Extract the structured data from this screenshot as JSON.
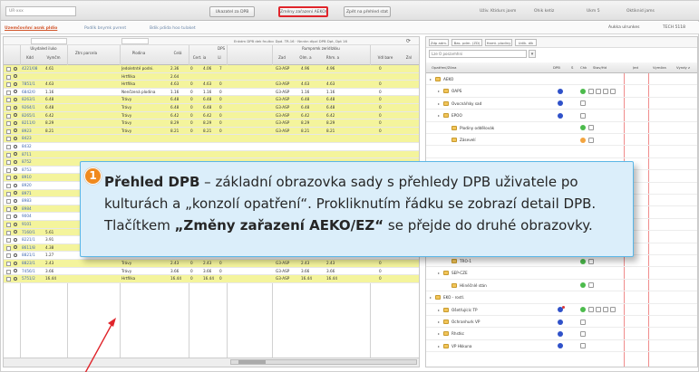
{
  "topbar": {
    "field_1": "UR·xxx",
    "button_1": "Ukazatel za DPB",
    "button_highlighted": "Změny zařazení AEKO/EZ",
    "button_3": "Zpět na přehled stat",
    "user_1": "Uživ. Ktidurs jaxm",
    "user_2": "Ohik ketiz",
    "user_3": "Ukm 5",
    "user_4": "Oktiknid jams"
  },
  "tabs": {
    "active": "Uzemčovňní asnk pldio",
    "tab_2": "Podílk bnymk pvrent",
    "tab_3": "Bdik pdida hoo tulaket",
    "right_label": "Aukka ulrunkes",
    "right_count": "TECH 5118"
  },
  "grid": {
    "filter_label": "Enkdm DPB dek fnultcc Dpd. TR.16 · Nnnkn dlpzl DPB Dpt, Dpt 16",
    "headers": {
      "group_1": "Ukydaled iluko",
      "group_2": "DPS",
      "group_3": "Rumpnmk zeridlzkku",
      "col_kod": "Kdd",
      "col_vymera": "Vymčm",
      "col_parcela": "Ztrs parcela",
      "col_plodina": "Plodina",
      "col_ha": "Celá",
      "col_cap": "Cert. ia",
      "col_ll": "Ll",
      "col_zad": "Zad",
      "col_obl": "Olm. a",
      "col_ha2": "Rhm. a",
      "col_val": "Vdl bare",
      "col_last": "Znl"
    },
    "rows": [
      {
        "kod": "4221/08",
        "vym": "4.61",
        "plod": "Jedoletnté podni.",
        "a": "2.36",
        "b": "0",
        "c": "4.06",
        "d": "7",
        "e": "G3·ASP",
        "f": "4.96",
        "g": "4.96",
        "h": "0"
      },
      {
        "kod": "",
        "vym": "",
        "plod": "Hrtfilka",
        "a": "2.64",
        "b": "",
        "c": "",
        "d": "",
        "e": "",
        "f": "",
        "g": "",
        "h": ""
      },
      {
        "kod": "7851/1",
        "vym": "4.63",
        "plod": "Hrtfilka",
        "a": "4.63",
        "b": "0",
        "c": "4.63",
        "d": "0",
        "e": "G3·ASP",
        "f": "4.63",
        "g": "4.63",
        "h": "0"
      },
      {
        "kod": "6842/0",
        "vym": "1.16",
        "plod": "Nenčzená plodina",
        "a": "1.16",
        "b": "0",
        "c": "1.16",
        "d": "0",
        "e": "G3·ASP",
        "f": "1.16",
        "g": "1.16",
        "h": "0"
      },
      {
        "kod": "8263/1",
        "vym": "6.48",
        "plod": "Trávy",
        "a": "6.48",
        "b": "0",
        "c": "6.48",
        "d": "0",
        "e": "G3·ASP",
        "f": "6.48",
        "g": "6.48",
        "h": "0"
      },
      {
        "kod": "9264/1",
        "vym": "6.48",
        "plod": "Trávy",
        "a": "6.48",
        "b": "0",
        "c": "6.48",
        "d": "0",
        "e": "G3·ASP",
        "f": "6.48",
        "g": "6.48",
        "h": "0"
      },
      {
        "kod": "8265/1",
        "vym": "6.42",
        "plod": "Trávy",
        "a": "6.42",
        "b": "0",
        "c": "6.42",
        "d": "0",
        "e": "G3·ASP",
        "f": "6.42",
        "g": "6.42",
        "h": "0"
      },
      {
        "kod": "8211/0",
        "vym": "8.29",
        "plod": "Trávy",
        "a": "8.29",
        "b": "0",
        "c": "8.29",
        "d": "0",
        "e": "G3·ASP",
        "f": "8.29",
        "g": "8.29",
        "h": "0"
      },
      {
        "kod": "8923",
        "vym": "8.21",
        "plod": "Trávy",
        "a": "8.21",
        "b": "0",
        "c": "8.21",
        "d": "0",
        "e": "G3·ASP",
        "f": "8.21",
        "g": "8.21",
        "h": "0"
      },
      {
        "kod": "8423",
        "vym": "",
        "plod": "",
        "a": "",
        "b": "",
        "c": "",
        "d": "",
        "e": "",
        "f": "",
        "g": "",
        "h": ""
      },
      {
        "kod": "8432",
        "vym": "",
        "plod": "",
        "a": "",
        "b": "",
        "c": "",
        "d": "",
        "e": "",
        "f": "",
        "g": "",
        "h": ""
      },
      {
        "kod": "8711",
        "vym": "",
        "plod": "",
        "a": "",
        "b": "",
        "c": "",
        "d": "",
        "e": "",
        "f": "",
        "g": "",
        "h": ""
      },
      {
        "kod": "8752",
        "vym": "",
        "plod": "",
        "a": "",
        "b": "",
        "c": "",
        "d": "",
        "e": "",
        "f": "",
        "g": "",
        "h": ""
      },
      {
        "kod": "8753",
        "vym": "",
        "plod": "",
        "a": "",
        "b": "",
        "c": "",
        "d": "",
        "e": "",
        "f": "",
        "g": "",
        "h": ""
      },
      {
        "kod": "8910",
        "vym": "",
        "plod": "",
        "a": "",
        "b": "",
        "c": "",
        "d": "",
        "e": "",
        "f": "",
        "g": "",
        "h": ""
      },
      {
        "kod": "8920",
        "vym": "",
        "plod": "",
        "a": "",
        "b": "",
        "c": "",
        "d": "",
        "e": "",
        "f": "",
        "g": "",
        "h": ""
      },
      {
        "kod": "8971",
        "vym": "",
        "plod": "",
        "a": "",
        "b": "",
        "c": "",
        "d": "",
        "e": "",
        "f": "",
        "g": "",
        "h": ""
      },
      {
        "kod": "8983",
        "vym": "",
        "plod": "",
        "a": "",
        "b": "",
        "c": "",
        "d": "",
        "e": "",
        "f": "",
        "g": "",
        "h": ""
      },
      {
        "kod": "8984",
        "vym": "",
        "plod": "",
        "a": "",
        "b": "",
        "c": "",
        "d": "",
        "e": "",
        "f": "",
        "g": "",
        "h": ""
      },
      {
        "kod": "9004",
        "vym": "",
        "plod": "",
        "a": "",
        "b": "",
        "c": "",
        "d": "",
        "e": "",
        "f": "",
        "g": "",
        "h": ""
      },
      {
        "kod": "9101",
        "vym": "",
        "plod": "",
        "a": "",
        "b": "",
        "c": "",
        "d": "",
        "e": "",
        "f": "",
        "g": "",
        "h": ""
      },
      {
        "kod": "7160/1",
        "vym": "5.61",
        "plod": "Hrtfilka",
        "a": "5.61",
        "b": "0",
        "c": "5.61",
        "d": "0",
        "e": "G3·ASP",
        "f": "5.61",
        "g": "5.61",
        "h": "0"
      },
      {
        "kod": "8221/1",
        "vym": "3.91",
        "plod": "Hrtfilka",
        "a": "3.91",
        "b": "0",
        "c": "3.91",
        "d": "0",
        "e": "G3·ASP",
        "f": "3.91",
        "g": "3.91",
        "h": "0"
      },
      {
        "kod": "8611/8",
        "vym": "4.38",
        "plod": "Trávy",
        "a": "4.38",
        "b": "0",
        "c": "4.38",
        "d": "0",
        "e": "G3·ASP",
        "f": "4.38",
        "g": "4.38",
        "h": "0"
      },
      {
        "kod": "8821/1",
        "vym": "1.27",
        "plod": "Trávy",
        "a": "1.27",
        "b": "0",
        "c": "1.27",
        "d": "0",
        "e": "G3·ASP",
        "f": "1.27",
        "g": "1.27",
        "h": "0"
      },
      {
        "kod": "8823/1",
        "vym": "2.43",
        "plod": "Trávy",
        "a": "2.43",
        "b": "0",
        "c": "2.43",
        "d": "0",
        "e": "G3·ASP",
        "f": "2.43",
        "g": "2.43",
        "h": "0"
      },
      {
        "kod": "7456/1",
        "vym": "3.66",
        "plod": "Trávy",
        "a": "3.66",
        "b": "0",
        "c": "3.66",
        "d": "0",
        "e": "G3·ASP",
        "f": "3.66",
        "g": "3.66",
        "h": "0"
      },
      {
        "kod": "5751/2",
        "vym": "16.44",
        "plod": "Hrtfilka",
        "a": "16.44",
        "b": "0",
        "c": "16.44",
        "d": "0",
        "e": "G3·ASP",
        "f": "16.44",
        "g": "16.44",
        "h": "0"
      }
    ]
  },
  "tree": {
    "toolbar_buttons": [
      "Zdp adm.",
      "Bas. pdm. (ZD)",
      "Hamt. plodiny",
      "Udlk. dlk"
    ],
    "search_value": "Lze O poszvmhni",
    "headers": {
      "name": "Opatření/Zóna",
      "dpb": "DPB",
      "s": "S",
      "chk": "Chk",
      "stav": "Stav/Hd",
      "jed": "Jed",
      "vym": "Vymöra",
      "vym2": "Vyndy z"
    },
    "rows": [
      {
        "label": "AEKO",
        "indent": 0,
        "markers": ""
      },
      {
        "label": "OAPS",
        "indent": 1,
        "markers": "blue,green,sq,sq,sq,sq"
      },
      {
        "label": "Ovocnářsky sad",
        "indent": 1,
        "markers": "blue,sq"
      },
      {
        "label": "EPOO",
        "indent": 1,
        "markers": "blue,sq"
      },
      {
        "label": "Plodiny oddělovák",
        "indent": 2,
        "markers": "green,sq"
      },
      {
        "label": "Zásevelí",
        "indent": 2,
        "markers": "orange,sq"
      },
      {
        "label": "",
        "indent": 2,
        "markers": ""
      },
      {
        "label": "",
        "indent": 2,
        "markers": ""
      },
      {
        "label": "",
        "indent": 2,
        "markers": ""
      },
      {
        "label": "",
        "indent": 2,
        "markers": ""
      },
      {
        "label": "",
        "indent": 2,
        "markers": ""
      },
      {
        "label": "",
        "indent": 2,
        "markers": ""
      },
      {
        "label": "",
        "indent": 2,
        "markers": ""
      },
      {
        "label": "",
        "indent": 2,
        "markers": ""
      },
      {
        "label": "",
        "indent": 2,
        "markers": ""
      },
      {
        "label": "TRO-1",
        "indent": 2,
        "markers": "green,sq"
      },
      {
        "label": "SEP-CZE",
        "indent": 1,
        "markers": ""
      },
      {
        "label": "Hlinéčnlé stán",
        "indent": 2,
        "markers": "green,sq"
      },
      {
        "label": "EKO - rostl.",
        "indent": 0,
        "markers": ""
      },
      {
        "label": "Ošetřujícíc TP",
        "indent": 1,
        "markers": "bluered,green,sq,sq,sq,sq"
      },
      {
        "label": "Ochranhurk VP",
        "indent": 1,
        "markers": "blue,sq"
      },
      {
        "label": "Rhstkc",
        "indent": 1,
        "markers": "blue,sq"
      },
      {
        "label": "VP Hkkuna",
        "indent": 1,
        "markers": "blue,sq"
      }
    ]
  },
  "callout": {
    "badge": "1",
    "lead": "Přehled DPB",
    "text_1": " – základní obrazovka sady s přehledy DPB uživatele po kulturách a „konzolí opatření“. Prokliknutím řádku se zobrazí detail DPB. Tlačítkem ",
    "strong_2": "„Změny zařazení AEKO/EZ“",
    "text_3": " se přejde do druhé obrazovky."
  },
  "colors": {
    "highlight_row": "#f4f49c",
    "callout_bg": "#dbeefa",
    "callout_border": "#5ab6e6",
    "badge": "#f08a1e",
    "highlight_border": "#e0252b",
    "active_tab": "#d2552b"
  }
}
